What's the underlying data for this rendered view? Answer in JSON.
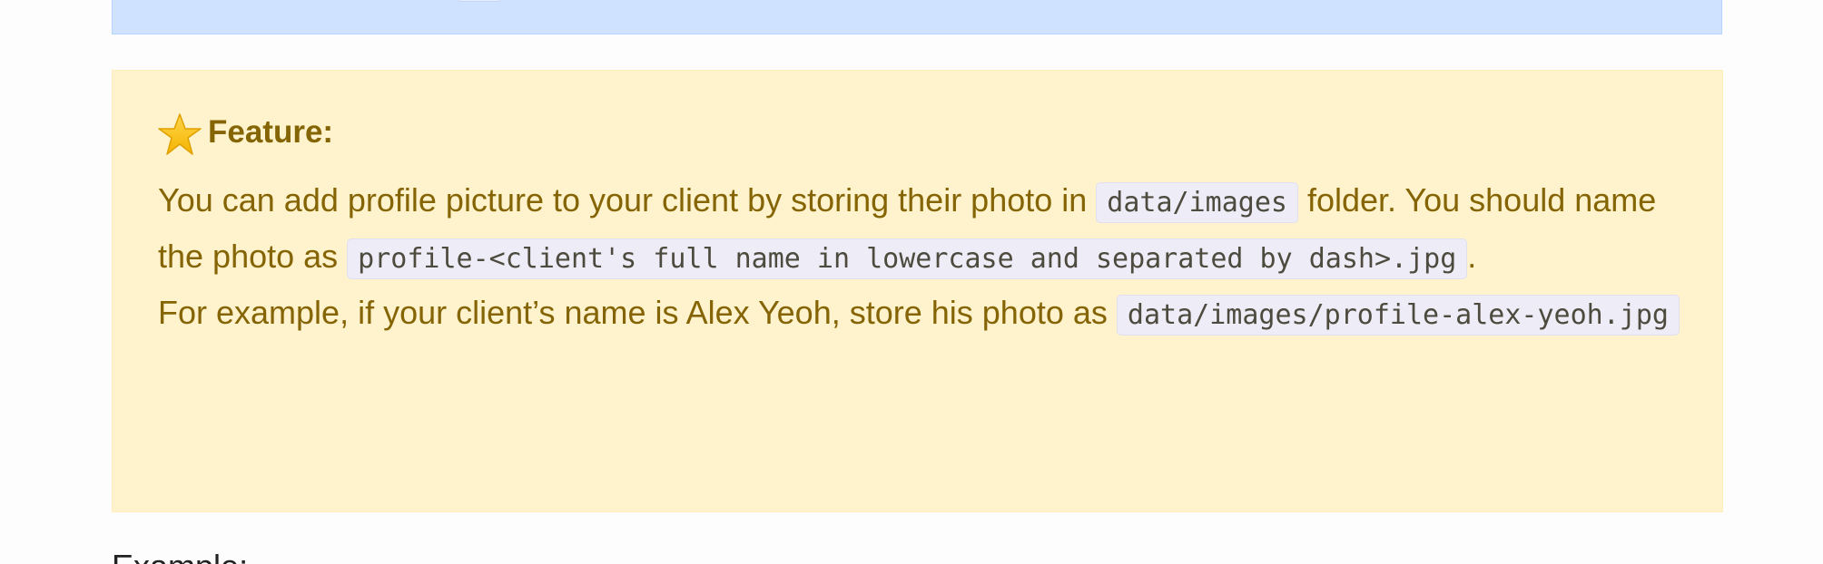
{
  "feature": {
    "title": "Feature:",
    "icon": "star-icon",
    "text1": "You can add profile picture to your client by storing their photo in ",
    "code1": "data/images",
    "text2": " folder. You should name the photo as ",
    "code2": "profile-<client's full name in lowercase and separated by dash>.jpg",
    "text3": ".",
    "text4": "For example, if your client’s name is Alex Yeoh, store his photo as ",
    "code3": "data/images/profile-alex-yeoh.jpg"
  },
  "next_section": {
    "heading": "Example:"
  },
  "colors": {
    "feature_bg": "#fff3cd",
    "feature_text": "#856404",
    "info_bg": "#cfe2ff",
    "code_bg": "#eeecf7"
  }
}
